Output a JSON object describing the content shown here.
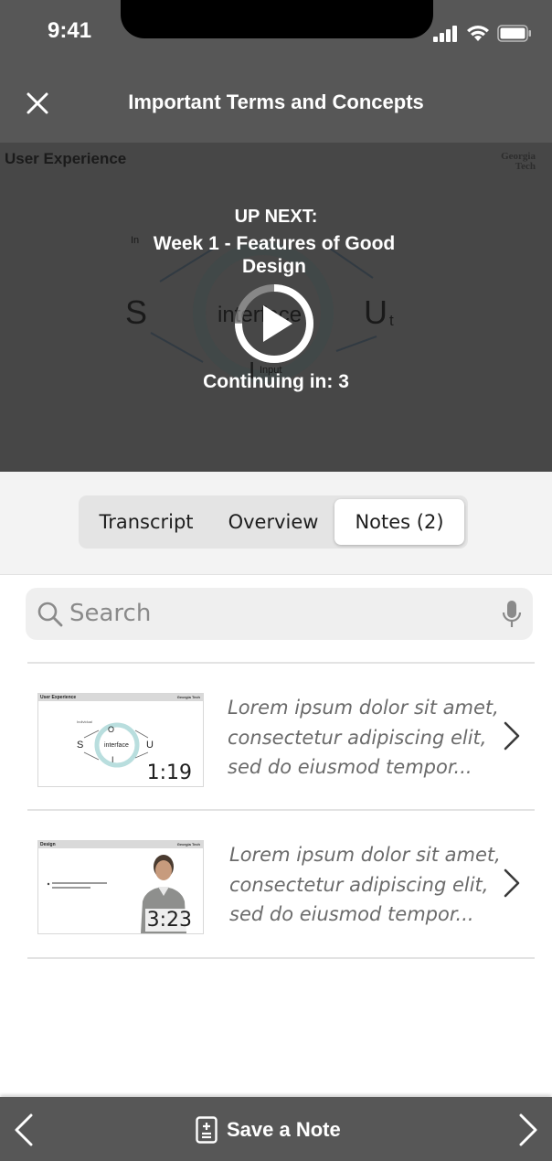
{
  "status_bar": {
    "time": "9:41"
  },
  "header": {
    "title": "Important Terms and Concepts",
    "close_icon": "close-icon"
  },
  "video": {
    "slide_title": "User Experience",
    "logo_line1": "Georgia",
    "logo_line2": "Tech",
    "diagram": {
      "s": "S",
      "u": "U",
      "u_sub": "t",
      "center": "interface",
      "input": "Input",
      "i": "I",
      "in": "In"
    },
    "up_next_label": "UP NEXT:",
    "up_next_title": "Week 1 - Features of Good Design",
    "countdown": "Continuing in: 3",
    "countdown_progress": 0.75
  },
  "tabs": {
    "items": [
      {
        "label": "Transcript"
      },
      {
        "label": "Overview"
      },
      {
        "label": "Notes (2)"
      }
    ],
    "selected": "Notes (2)"
  },
  "search": {
    "placeholder": "Search",
    "value": ""
  },
  "notes": [
    {
      "duration": "1:19",
      "thumb_title": "User Experience",
      "thumb_logo": "Georgia Tech",
      "line1": "Lorem ipsum dolor sit amet,",
      "line2": "consectetur adipiscing elit,",
      "line3": "sed do eiusmod tempor..."
    },
    {
      "duration": "3:23",
      "thumb_title": "Design",
      "thumb_logo": "Georgia Tech",
      "line1": "Lorem ipsum dolor sit amet,",
      "line2": "consectetur adipiscing elit,",
      "line3": "sed do eiusmod tempor..."
    }
  ],
  "bottom_bar": {
    "save_label": "Save a Note"
  },
  "colors": {
    "header_bg": "#575757",
    "video_bg": "#474747",
    "tab_bg": "#e4e4e4"
  }
}
